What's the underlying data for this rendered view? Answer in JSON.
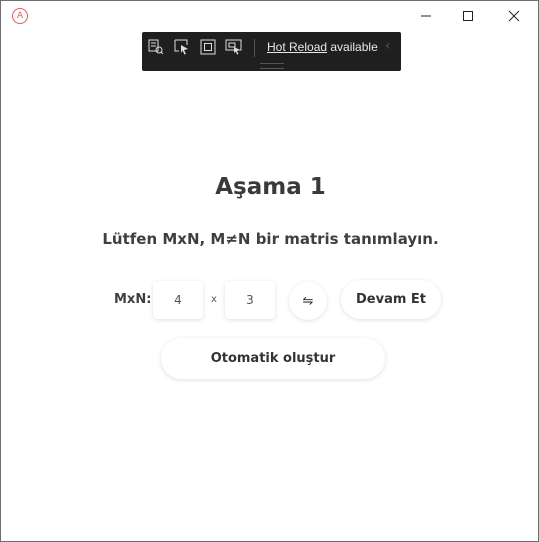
{
  "titlebar": {
    "app_icon": "A",
    "minimize_icon": "minimize-icon",
    "maximize_icon": "maximize-icon",
    "close_icon": "close-icon"
  },
  "devbar": {
    "tools": [
      "live-visual-tree-icon",
      "select-element-icon",
      "display-layout-adorners-icon",
      "track-focused-element-icon"
    ],
    "hot_reload_link": "Hot Reload",
    "hot_reload_status": " available",
    "collapse_glyph": "‹"
  },
  "main": {
    "title": "Aşama 1",
    "instruction": "Lütfen MxN, M≠N bir matris tanımlayın.",
    "mxn_label": "MxN:",
    "m_value": "4",
    "times": "x",
    "n_value": "3",
    "swap_glyph": "⇋",
    "continue_label": "Devam Et",
    "auto_generate_label": "Otomatik oluştur"
  },
  "colors": {
    "background": "#ffffff",
    "devbar": "#1f1f1f",
    "app_icon": "#e05a5a",
    "text": "#3a3a3a"
  }
}
